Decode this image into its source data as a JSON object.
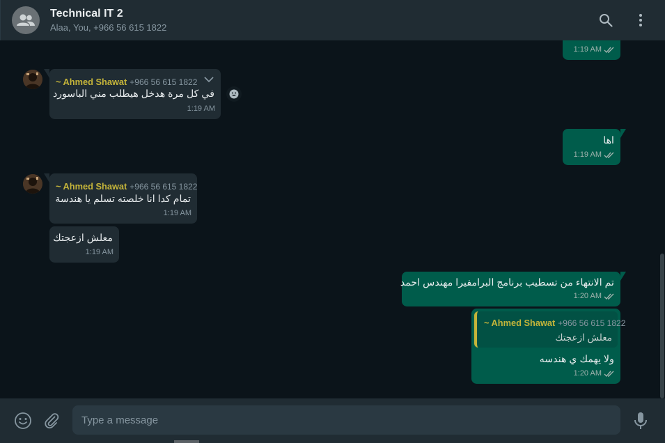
{
  "header": {
    "title": "Technical IT 2",
    "subtitle": "Alaa, You, +966 56 615 1822",
    "avatar_icon": "group-icon",
    "search_icon": "search-icon",
    "menu_icon": "menu-dots-icon"
  },
  "messages": [
    {
      "id": "m0",
      "direction": "out",
      "time": "1:19 AM",
      "status": "read"
    },
    {
      "id": "m1",
      "direction": "in",
      "sender": "~ Ahmed Shawat",
      "phone": "+966 56 615 1822",
      "text": "في كل مرة هدخل هيطلب مني الباسورد",
      "time": "1:19 AM"
    },
    {
      "id": "m2",
      "direction": "out",
      "text": "اها",
      "time": "1:19 AM",
      "status": "read"
    },
    {
      "id": "m3",
      "direction": "in",
      "sender": "~ Ahmed Shawat",
      "phone": "+966 56 615 1822",
      "text": "تمام كدا انا خلصته تسلم يا هندسة",
      "time": "1:19 AM"
    },
    {
      "id": "m4",
      "direction": "in",
      "text": "معلش ازعجتك",
      "time": "1:19 AM"
    },
    {
      "id": "m5",
      "direction": "out",
      "text": "تم الانتهاء من تسطيب برنامج البرامفيرا مهندس احمد",
      "time": "1:20 AM",
      "status": "read"
    },
    {
      "id": "m6",
      "direction": "out",
      "quote": {
        "sender": "~ Ahmed Shawat",
        "phone": "+966 56 615 1822",
        "text": "معلش ازعجتك"
      },
      "text": "ولا يهمك ي هندسه",
      "time": "1:20 AM",
      "status": "read"
    }
  ],
  "composer": {
    "placeholder": "Type a message",
    "emoji_icon": "emoji-icon",
    "attach_icon": "paperclip-icon",
    "mic_icon": "microphone-icon"
  },
  "colors": {
    "header_bg": "#202c33",
    "chat_bg": "#0b141a",
    "incoming_bubble": "#202c33",
    "outgoing_bubble": "#005c4b",
    "sender_name": "#c4b43a",
    "read_ticks": "#53bdeb"
  }
}
